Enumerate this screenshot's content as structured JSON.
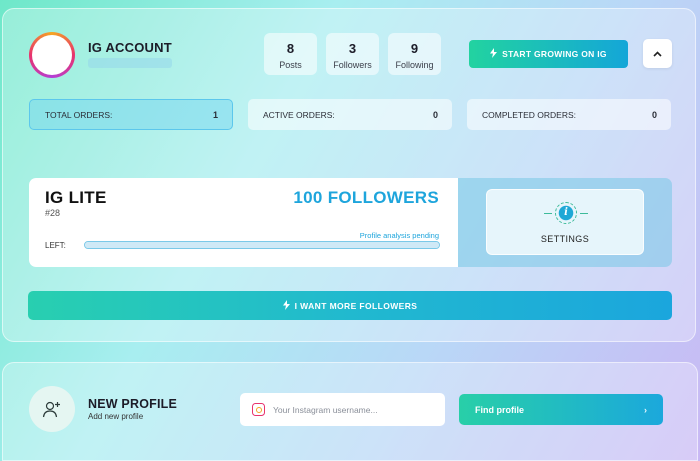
{
  "account": {
    "title": "IG ACCOUNT",
    "stats": [
      {
        "value": "8",
        "label": "Posts"
      },
      {
        "value": "3",
        "label": "Followers"
      },
      {
        "value": "9",
        "label": "Following"
      }
    ],
    "grow_button": "START GROWING ON IG",
    "collapse_icon": "chevron-up-icon"
  },
  "orders": {
    "total": {
      "label": "TOTAL ORDERS:",
      "value": "1"
    },
    "active": {
      "label": "ACTIVE ORDERS:",
      "value": "0"
    },
    "completed": {
      "label": "COMPLETED ORDERS:",
      "value": "0"
    }
  },
  "plan": {
    "name": "IG LITE",
    "id": "#28",
    "quantity": "100 FOLLOWERS",
    "status": "Profile analysis pending",
    "left_label": "LEFT:",
    "progress": 1.0,
    "settings_label": "SETTINGS"
  },
  "more_button": "I WANT MORE FOLLOWERS",
  "new_profile": {
    "title": "NEW PROFILE",
    "subtitle": "Add new profile",
    "input_placeholder": "Your Instagram username...",
    "find_button": "Find profile",
    "find_arrow": "›"
  },
  "colors": {
    "accent_blue": "#1ea5dc",
    "accent_green": "#22d3a0",
    "instagram_pink": "#e8336d"
  }
}
